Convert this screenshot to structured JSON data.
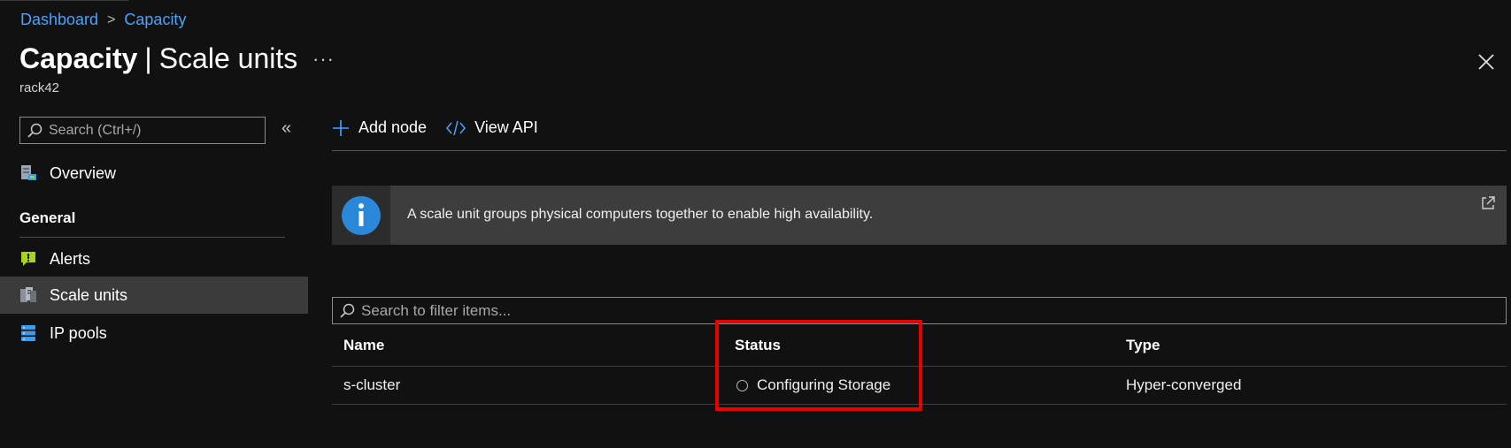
{
  "breadcrumb": {
    "items": [
      "Dashboard",
      "Capacity"
    ]
  },
  "header": {
    "title_bold": "Capacity",
    "title_rest": "Scale units",
    "subtitle": "rack42",
    "more_label": "···"
  },
  "sidebar": {
    "search_placeholder": "Search (Ctrl+/)",
    "collapse_label": "«",
    "overview": "Overview",
    "section_general": "General",
    "items": [
      "Alerts",
      "Scale units",
      "IP pools"
    ],
    "active_item": "Scale units"
  },
  "toolbar": {
    "add_node": "Add node",
    "view_api": "View API"
  },
  "banner": {
    "text": "A scale unit groups physical computers together to enable high availability."
  },
  "filter": {
    "placeholder": "Search to filter items..."
  },
  "table": {
    "columns": [
      "Name",
      "Status",
      "Type"
    ],
    "rows": [
      {
        "name": "s-cluster",
        "status": "Configuring Storage",
        "type": "Hyper-converged"
      }
    ]
  },
  "colors": {
    "accent": "#4aa3ff",
    "highlight": "#e80000",
    "active_bg": "#3b3b3b"
  }
}
